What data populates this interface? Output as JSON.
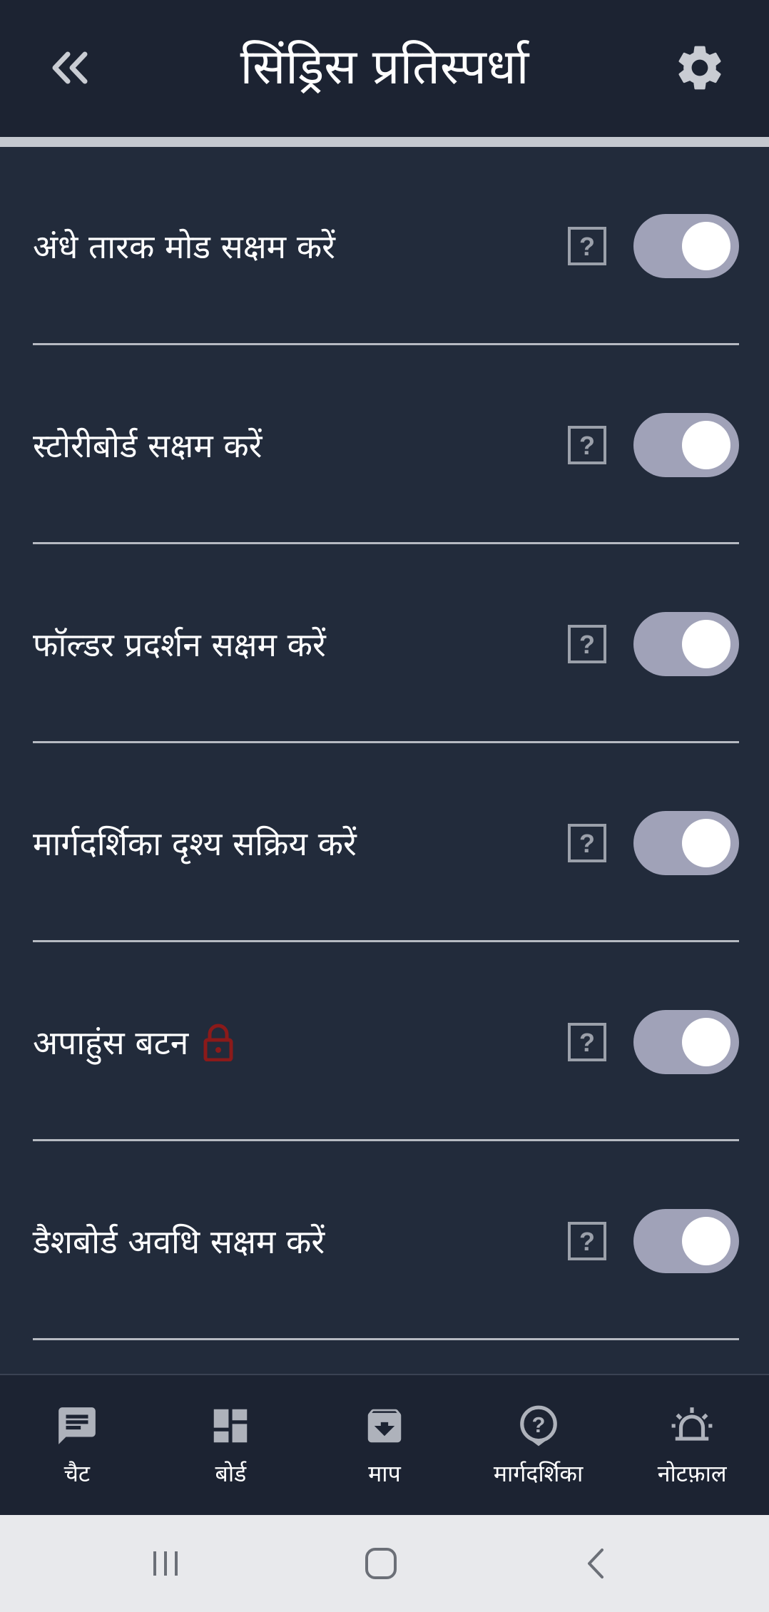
{
  "header": {
    "title": "सिंड्रिस प्रतिस्पर्धा",
    "back_icon": "double-chevron-left-icon",
    "settings_icon": "gear-icon"
  },
  "settings": [
    {
      "label": "अंधे तारक मोड सक्षम करें",
      "enabled": true,
      "locked": false
    },
    {
      "label": "स्टोरीबोर्ड सक्षम करें",
      "enabled": true,
      "locked": false
    },
    {
      "label": "फॉल्डर प्रदर्शन सक्षम करें",
      "enabled": true,
      "locked": false
    },
    {
      "label": "मार्गदर्शिका दृश्य सक्रिय करें",
      "enabled": true,
      "locked": false
    },
    {
      "label": "अपाहुंस बटन",
      "enabled": true,
      "locked": true
    },
    {
      "label": "डैशबोर्ड अवधि सक्षम करें",
      "enabled": true,
      "locked": false
    }
  ],
  "bottom_nav": [
    {
      "label": "चैट",
      "icon": "chat-icon"
    },
    {
      "label": "बोर्ड",
      "icon": "dashboard-icon"
    },
    {
      "label": "माप",
      "icon": "archive-download-icon"
    },
    {
      "label": "मार्गदर्शिका",
      "icon": "help-circle-icon"
    },
    {
      "label": "नोटफ़ाल",
      "icon": "siren-icon"
    }
  ],
  "colors": {
    "background": "#222b3b",
    "header": "#1c2332",
    "toggle_track": "#a0a2b8",
    "lock": "#8b1a1a"
  }
}
